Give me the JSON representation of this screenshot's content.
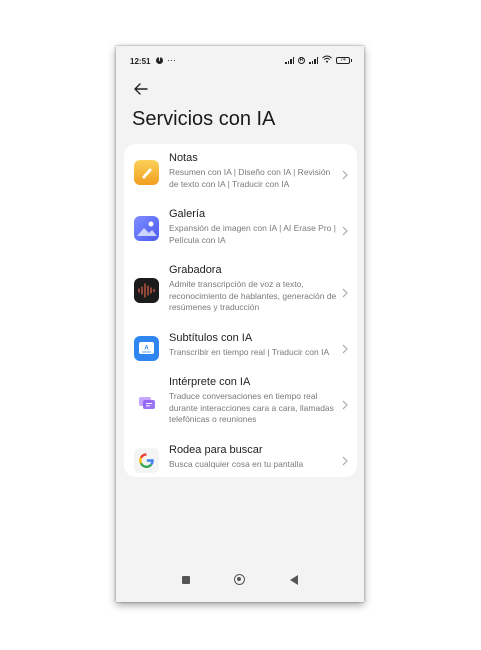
{
  "status_bar": {
    "time": "12:51",
    "app_badge": "f",
    "more": "···",
    "sim_badge": "R",
    "battery": "74"
  },
  "header": {
    "title": "Servicios con IA"
  },
  "services": [
    {
      "name": "Notas",
      "description": "Resumen con IA | Diseño con IA | Revisión de texto con IA | Traducir con IA",
      "icon": "notes-icon"
    },
    {
      "name": "Galería",
      "description": "Expansión de imagen con IA | AI Erase Pro | Película con IA",
      "icon": "gallery-icon"
    },
    {
      "name": "Grabadora",
      "description": "Admite transcripción de voz a texto, reconocimiento de hablantes, generación de resúmenes y traducción",
      "icon": "recorder-icon"
    },
    {
      "name": "Subtítulos con IA",
      "description": "Transcribir en tiempo real | Traducir con IA",
      "icon": "subtitles-icon"
    },
    {
      "name": "Intérprete con IA",
      "description": "Traduce conversaciones en tiempo real durante interacciones cara a cara, llamadas telefónicas o reuniones",
      "icon": "interpreter-icon"
    },
    {
      "name": "Rodea para buscar",
      "description": "Busca cualquier cosa en tu pantalla",
      "icon": "google-icon"
    }
  ],
  "colors": {
    "screen_background": "#f3f3f3",
    "card_background": "#ffffff",
    "notes_accent": "#f6b22e",
    "gallery_accent": "#5b6ef5",
    "subtitles_accent": "#2f86f0",
    "interpreter_accent": "#8a5cf0"
  }
}
